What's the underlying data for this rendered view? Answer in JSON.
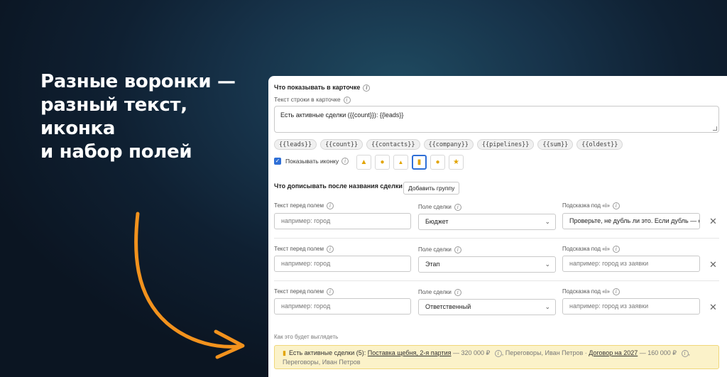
{
  "headline": [
    "Разные воронки —",
    "разный текст, иконка",
    "и набор полей"
  ],
  "card": {
    "title": "Что показывать в карточке",
    "row_text_label": "Текст строки в карточке",
    "row_text_value": "Есть активные сделки ({{count}}): {{leads}}",
    "chips": [
      "{{leads}}",
      "{{count}}",
      "{{contacts}}",
      "{{company}}",
      "{{pipelines}}",
      "{{sum}}",
      "{{oldest}}"
    ],
    "show_icon_label": "Показывать иконку",
    "show_icon_checked": true,
    "icon_options": [
      "warning-icon",
      "info-circle-icon",
      "bell-icon",
      "document-icon",
      "person-icon",
      "star-icon"
    ],
    "selected_icon": "document-icon"
  },
  "append": {
    "title": "Что дописывать после названия сделки",
    "add_group_label": "Добавить группу"
  },
  "rows": [
    {
      "text_before_label": "Текст перед полем",
      "text_before_placeholder": "например: город",
      "deal_field_label": "Поле сделки",
      "deal_field_value": "Бюджет",
      "hint_label": "Подсказка под «i»",
      "hint_value": "Проверьте, не дубль ли это. Если дубль — объ",
      "hint_is_placeholder": false
    },
    {
      "text_before_label": "Текст перед полем",
      "text_before_placeholder": "например: город",
      "deal_field_label": "Поле сделки",
      "deal_field_value": "Этап",
      "hint_label": "Подсказка под «i»",
      "hint_value": "например: город из заявки",
      "hint_is_placeholder": true
    },
    {
      "text_before_label": "Текст перед полем",
      "text_before_placeholder": "например: город",
      "deal_field_label": "Поле сделки",
      "deal_field_value": "Ответственный",
      "hint_label": "Подсказка под «i»",
      "hint_value": "например: город из заявки",
      "hint_is_placeholder": true
    }
  ],
  "preview": {
    "label": "Как это будет выглядеть",
    "lead_text": "Есть активные сделки (5):",
    "deal1_link": "Поставка щебня, 2-я партия",
    "deal1_amount": "— 320 000 ₽",
    "deal1_extra": ", Переговоры, Иван Петров ·",
    "deal2_link": "Договор на 2027",
    "deal2_amount": "— 160 000 ₽",
    "deal2_extra": ", Переговоры,",
    "deal2_extra_line2": "Иван Петров"
  },
  "colors": {
    "accent_blue": "#2f6fd6",
    "icon_yellow": "#e2a400",
    "arrow_orange": "#f2921d",
    "preview_bg": "#fbf2c9"
  }
}
